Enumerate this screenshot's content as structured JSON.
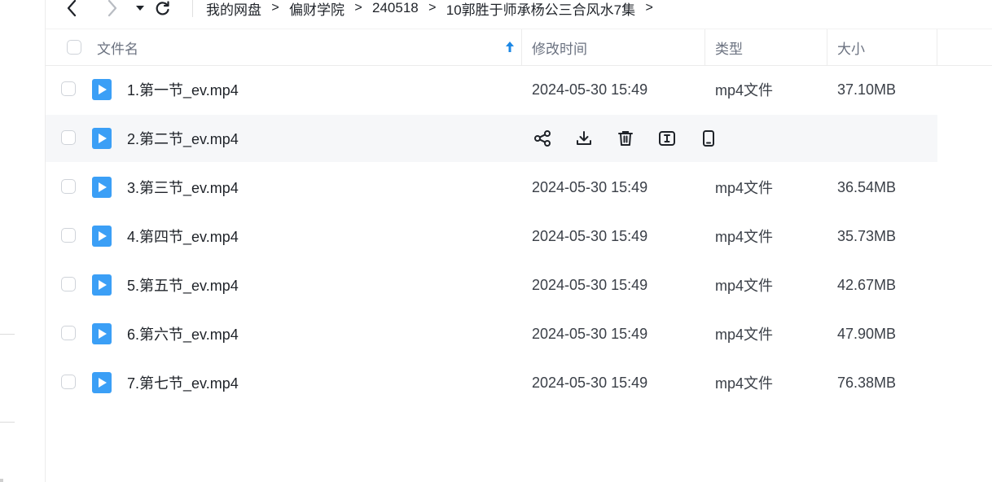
{
  "breadcrumb": {
    "items": [
      "我的网盘",
      "偏财学院",
      "240518",
      "10郭胜于师承杨公三合风水7集"
    ],
    "separator": ">"
  },
  "table": {
    "headers": {
      "name": "文件名",
      "modified": "修改时间",
      "type": "类型",
      "size": "大小"
    },
    "hover_row_index": 1,
    "rows": [
      {
        "name": "1.第一节_ev.mp4",
        "modified": "2024-05-30 15:49",
        "type": "mp4文件",
        "size": "37.10MB"
      },
      {
        "name": "2.第二节_ev.mp4",
        "modified": "",
        "type": "",
        "size": ""
      },
      {
        "name": "3.第三节_ev.mp4",
        "modified": "2024-05-30 15:49",
        "type": "mp4文件",
        "size": "36.54MB"
      },
      {
        "name": "4.第四节_ev.mp4",
        "modified": "2024-05-30 15:49",
        "type": "mp4文件",
        "size": "35.73MB"
      },
      {
        "name": "5.第五节_ev.mp4",
        "modified": "2024-05-30 15:49",
        "type": "mp4文件",
        "size": "42.67MB"
      },
      {
        "name": "6.第六节_ev.mp4",
        "modified": "2024-05-30 15:49",
        "type": "mp4文件",
        "size": "47.90MB"
      },
      {
        "name": "7.第七节_ev.mp4",
        "modified": "2024-05-30 15:49",
        "type": "mp4文件",
        "size": "76.38MB"
      }
    ],
    "hover_actions": [
      "share-icon",
      "download-icon",
      "delete-icon",
      "rename-icon",
      "phone-icon"
    ]
  },
  "colors": {
    "file_icon": "#3b9ff6",
    "accent": "#1e88e5",
    "hover_row": "#f6f7f9"
  }
}
